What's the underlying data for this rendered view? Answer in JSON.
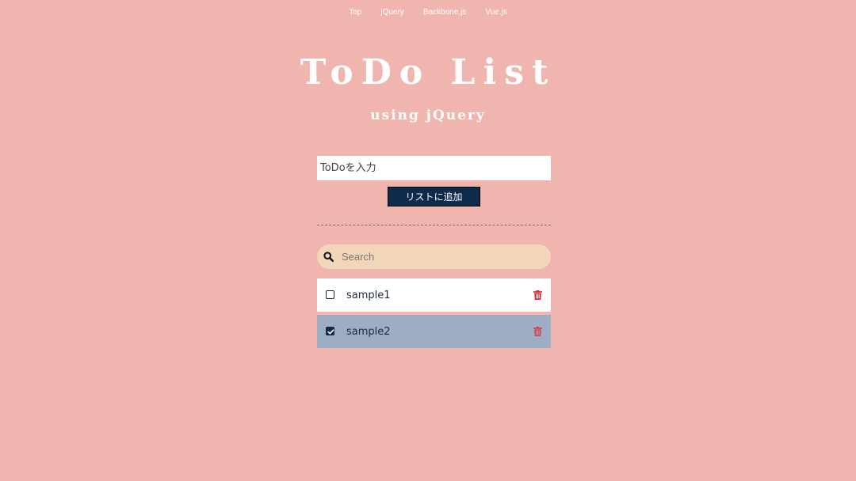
{
  "nav": {
    "items": [
      "Top",
      "jQuery",
      "Backbone.js",
      "Vue.js"
    ]
  },
  "header": {
    "title": "ToDo List",
    "subtitle": "using jQuery"
  },
  "form": {
    "input_placeholder": "ToDoを入力",
    "input_value": "",
    "add_button_label": "リストに追加"
  },
  "search": {
    "placeholder": "Search",
    "value": "",
    "icon": "search-icon"
  },
  "todos": [
    {
      "label": "sample1",
      "checked": false
    },
    {
      "label": "sample2",
      "checked": true
    }
  ],
  "colors": {
    "background": "#f1b5b0",
    "accent": "#0f2b4c",
    "search_background": "#f2d6ba",
    "done_item_background": "#9dadc3",
    "delete_icon": "#e0202a"
  }
}
